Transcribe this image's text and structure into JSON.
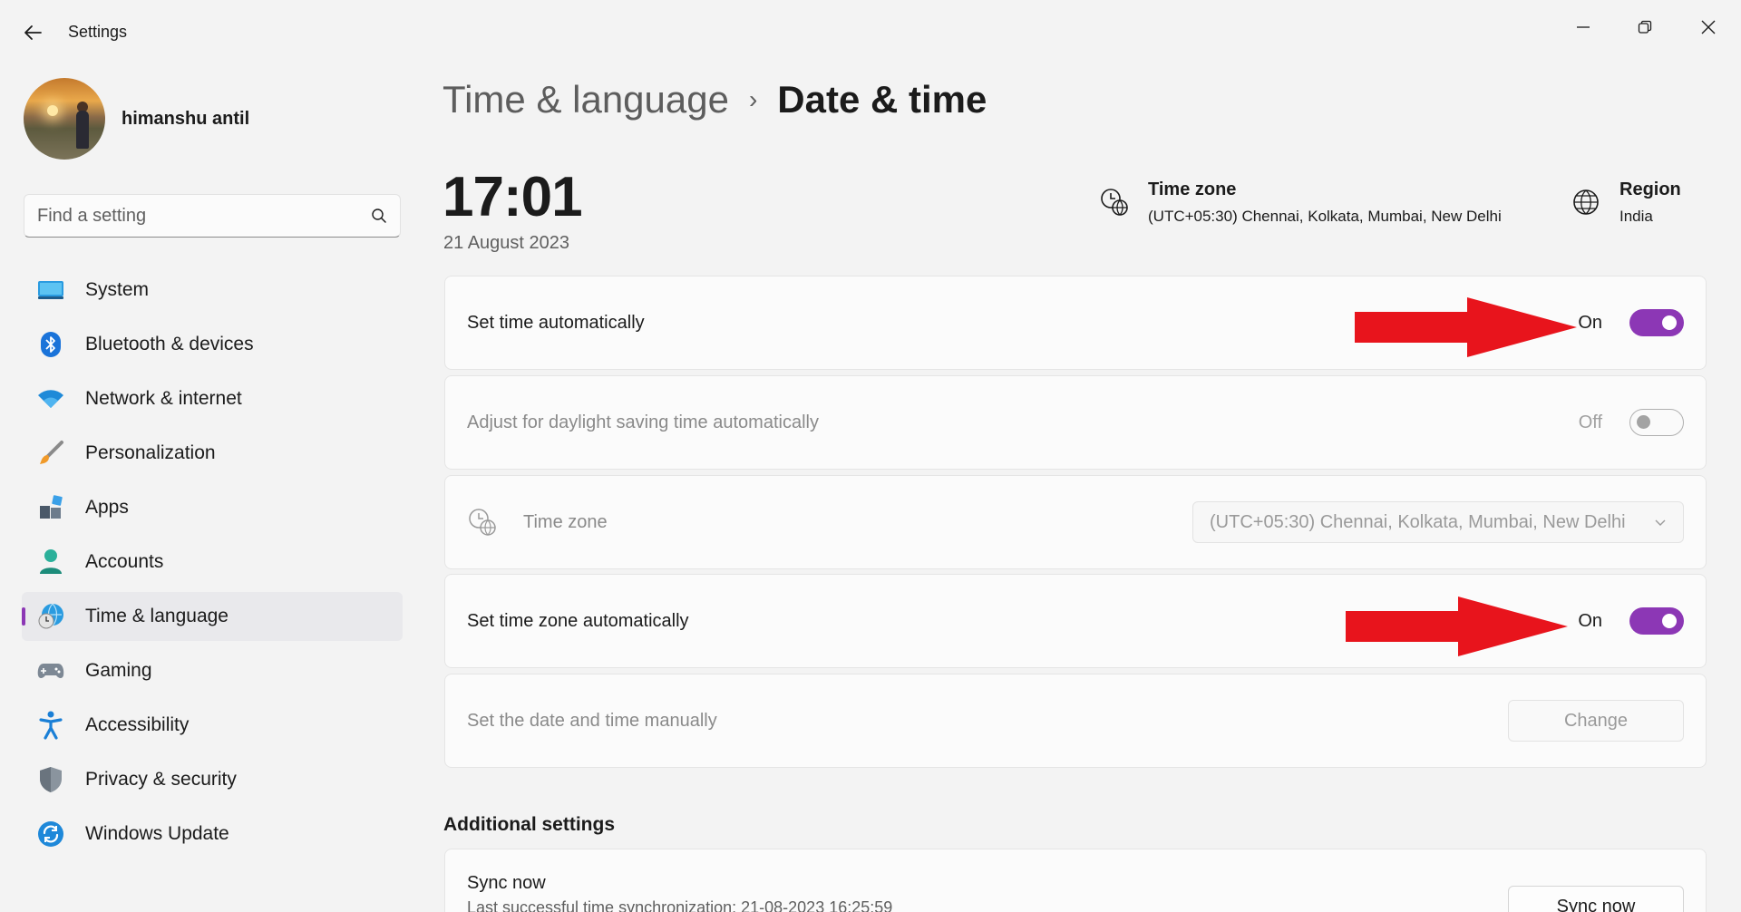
{
  "window": {
    "title": "Settings"
  },
  "profile": {
    "name": "himanshu antil"
  },
  "search": {
    "placeholder": "Find a setting"
  },
  "sidebar": {
    "items": [
      {
        "label": "System",
        "icon": "system-icon"
      },
      {
        "label": "Bluetooth & devices",
        "icon": "bluetooth-icon"
      },
      {
        "label": "Network & internet",
        "icon": "wifi-icon"
      },
      {
        "label": "Personalization",
        "icon": "brush-icon"
      },
      {
        "label": "Apps",
        "icon": "apps-icon"
      },
      {
        "label": "Accounts",
        "icon": "accounts-icon"
      },
      {
        "label": "Time & language",
        "icon": "time-language-icon",
        "active": true
      },
      {
        "label": "Gaming",
        "icon": "gamepad-icon"
      },
      {
        "label": "Accessibility",
        "icon": "accessibility-icon"
      },
      {
        "label": "Privacy & security",
        "icon": "shield-icon"
      },
      {
        "label": "Windows Update",
        "icon": "update-icon"
      }
    ]
  },
  "breadcrumb": {
    "parent": "Time & language",
    "separator": "›",
    "current": "Date & time"
  },
  "clock": {
    "time": "17:01",
    "date": "21 August 2023"
  },
  "header_info": {
    "timezone_title": "Time zone",
    "timezone_value": "(UTC+05:30) Chennai, Kolkata, Mumbai, New Delhi",
    "region_title": "Region",
    "region_value": "India"
  },
  "settings": {
    "set_time_auto": {
      "label": "Set time automatically",
      "state": "On"
    },
    "daylight": {
      "label": "Adjust for daylight saving time automatically",
      "state": "Off"
    },
    "timezone": {
      "label": "Time zone",
      "value": "(UTC+05:30) Chennai, Kolkata, Mumbai, New Delhi"
    },
    "set_tz_auto": {
      "label": "Set time zone automatically",
      "state": "On"
    },
    "manual": {
      "label": "Set the date and time manually",
      "button": "Change"
    }
  },
  "additional": {
    "title": "Additional settings",
    "sync_title": "Sync now",
    "sync_sub": "Last successful time synchronization: 21-08-2023 16:25:59",
    "sync_button": "Sync now"
  },
  "colors": {
    "accent": "#8c37b5",
    "annotation_arrow": "#e8141c"
  }
}
